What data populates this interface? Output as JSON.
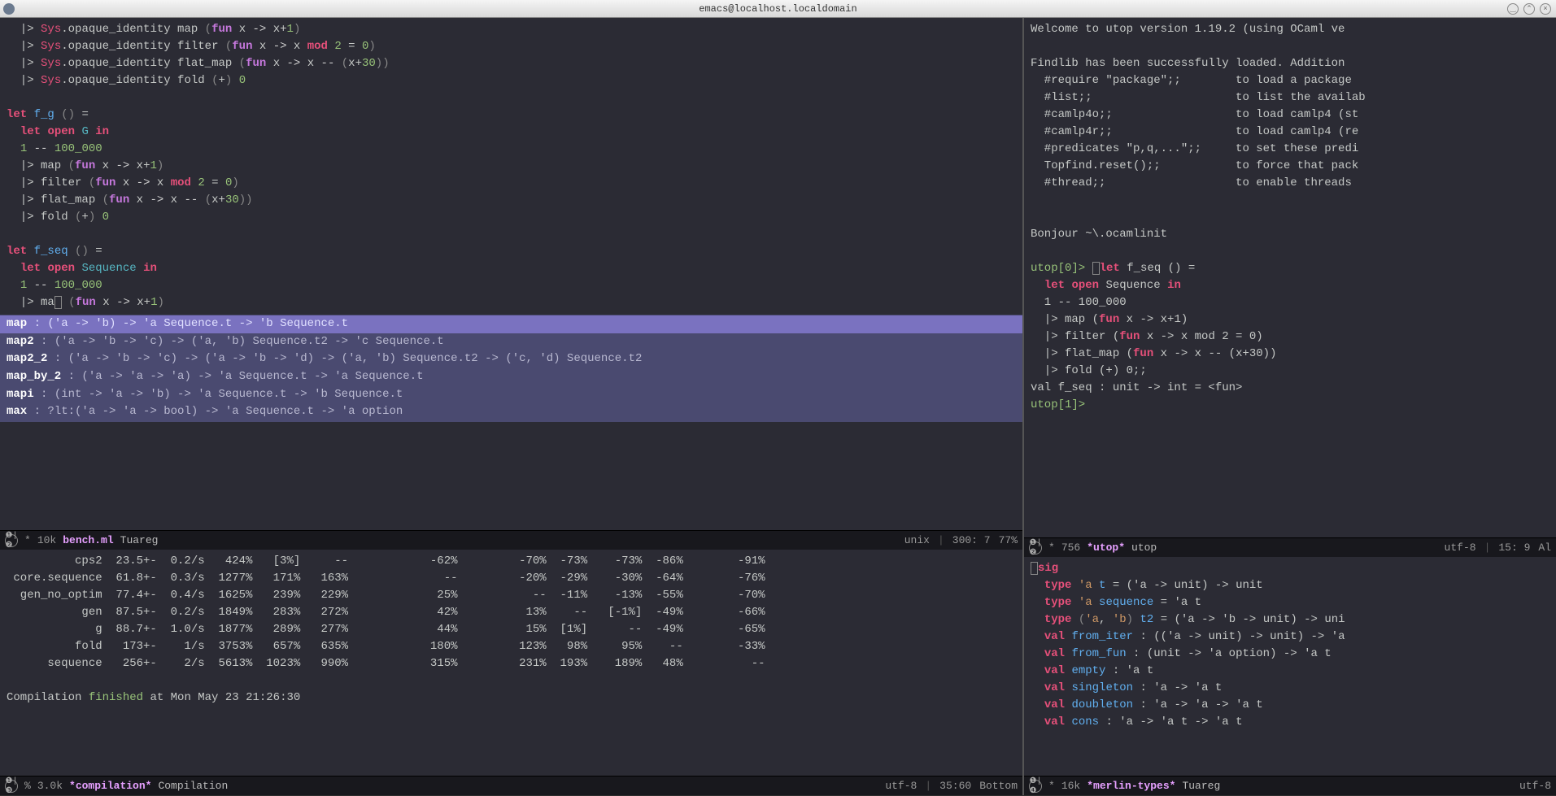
{
  "window": {
    "title": "emacs@localhost.localdomain"
  },
  "topLeft": {
    "modeline": {
      "indicators": "❶|❷",
      "modified": "*",
      "size": "10k",
      "buffer": "bench.ml",
      "mode": "Tuareg",
      "env": "unix",
      "pos": "300: 7",
      "pct": "77%"
    },
    "completion": [
      {
        "name": "map",
        "sig": " : ('a -> 'b) -> 'a Sequence.t -> 'b Sequence.t",
        "sel": true
      },
      {
        "name": "map2",
        "sig": " : ('a -> 'b -> 'c) -> ('a, 'b) Sequence.t2 -> 'c Sequence.t",
        "sel": false
      },
      {
        "name": "map2_2",
        "sig": " : ('a -> 'b -> 'c) -> ('a -> 'b -> 'd) -> ('a, 'b) Sequence.t2 -> ('c, 'd) Sequence.t2",
        "sel": false
      },
      {
        "name": "map_by_2",
        "sig": " : ('a -> 'a -> 'a) -> 'a Sequence.t -> 'a Sequence.t",
        "sel": false
      },
      {
        "name": "mapi",
        "sig": " : (int -> 'a -> 'b) -> 'a Sequence.t -> 'b Sequence.t",
        "sel": false
      },
      {
        "name": "max",
        "sig": " : ?lt:('a -> 'a -> bool) -> 'a Sequence.t -> 'a option",
        "sel": false
      }
    ]
  },
  "bottomLeft": {
    "modeline": {
      "indicators": "❶|❸",
      "modified": "%",
      "size": "3.0k",
      "buffer": "*compilation*",
      "mode": "Compilation",
      "enc": "utf-8",
      "pos": "35:60",
      "pct": "Bottom"
    },
    "rows": [
      {
        "name": "cps2",
        "rate": "23.5+-",
        "per": "0.2/s",
        "c1": "424%",
        "c2": "[3%]",
        "c3": "--",
        "c4": "-62%",
        "c5": "-70%",
        "c6": "-73%",
        "c7": "-73%",
        "c8": "-86%",
        "c9": "-91%"
      },
      {
        "name": "core.sequence",
        "rate": "61.8+-",
        "per": "0.3/s",
        "c1": "1277%",
        "c2": "171%",
        "c3": "163%",
        "c4": "--",
        "c5": "-20%",
        "c6": "-29%",
        "c7": "-30%",
        "c8": "-64%",
        "c9": "-76%"
      },
      {
        "name": "gen_no_optim",
        "rate": "77.4+-",
        "per": "0.4/s",
        "c1": "1625%",
        "c2": "239%",
        "c3": "229%",
        "c4": "25%",
        "c5": "--",
        "c6": "-11%",
        "c7": "-13%",
        "c8": "-55%",
        "c9": "-70%"
      },
      {
        "name": "gen",
        "rate": "87.5+-",
        "per": "0.2/s",
        "c1": "1849%",
        "c2": "283%",
        "c3": "272%",
        "c4": "42%",
        "c5": "13%",
        "c6": "--",
        "c7": "[-1%]",
        "c8": "-49%",
        "c9": "-66%"
      },
      {
        "name": "g",
        "rate": "88.7+-",
        "per": "1.0/s",
        "c1": "1877%",
        "c2": "289%",
        "c3": "277%",
        "c4": "44%",
        "c5": "15%",
        "c6": "[1%]",
        "c7": "--",
        "c8": "-49%",
        "c9": "-65%"
      },
      {
        "name": "fold",
        "rate": "173+-",
        "per": "1/s",
        "c1": "3753%",
        "c2": "657%",
        "c3": "635%",
        "c4": "180%",
        "c5": "123%",
        "c6": "98%",
        "c7": "95%",
        "c8": "--",
        "c9": "-33%"
      },
      {
        "name": "sequence",
        "rate": "256+-",
        "per": "2/s",
        "c1": "5613%",
        "c2": "1023%",
        "c3": "990%",
        "c4": "315%",
        "c5": "231%",
        "c6": "193%",
        "c7": "189%",
        "c8": "48%",
        "c9": "--"
      }
    ],
    "compilation": {
      "prefix": "Compilation ",
      "status": "finished",
      "suffix": " at Mon May 23 21:26:30"
    }
  },
  "topRight": {
    "modeline": {
      "indicators": "❶|❷",
      "modified": "*",
      "size": "756",
      "buffer": "*utop*",
      "mode": "utop",
      "enc": "utf-8",
      "pos": "15: 9",
      "pct": "Al"
    },
    "welcome": "Welcome to utop version 1.19.2 (using OCaml ve",
    "findlib": "Findlib has been successfully loaded. Addition",
    "directives": [
      {
        "cmd": "#require \"package\";;",
        "desc": "to load a package"
      },
      {
        "cmd": "#list;;",
        "desc": "to list the availab"
      },
      {
        "cmd": "#camlp4o;;",
        "desc": "to load camlp4 (st"
      },
      {
        "cmd": "#camlp4r;;",
        "desc": "to load camlp4 (re"
      },
      {
        "cmd": "#predicates \"p,q,...\";;",
        "desc": "to set these predi"
      },
      {
        "cmd": "Topfind.reset();;",
        "desc": "to force that pack"
      },
      {
        "cmd": "#thread;;",
        "desc": "to enable threads"
      }
    ],
    "bonjour": "Bonjour ~\\.ocamlinit",
    "prompt0": "utop[0]>",
    "prompt1": "utop[1]>",
    "valResult": "val f_seq : unit -> int = <fun>"
  },
  "bottomRight": {
    "modeline": {
      "indicators": "❶|❹",
      "modified": "*",
      "size": "16k",
      "buffer": "*merlin-types*",
      "mode": "Tuareg",
      "enc": "utf-8"
    }
  }
}
